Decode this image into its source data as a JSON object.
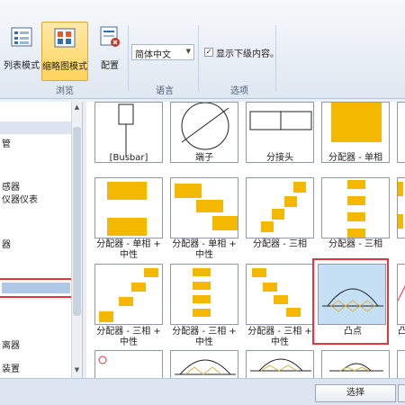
{
  "ribbon": {
    "list_mode": "列表模式",
    "thumb_mode": "缩略图模式",
    "config": "配置",
    "browse_group": "浏览",
    "language_value": "简体中文",
    "language_group": "语言",
    "show_sub": "显示下级内容。",
    "options_group": "选项"
  },
  "tree": {
    "items": [
      "管",
      "感器",
      "仪器仪表",
      "器",
      "离器",
      "装置"
    ]
  },
  "gallery": {
    "row1": [
      "[Busbar]",
      "端子",
      "分接头",
      "分配器 - 单相"
    ],
    "row2": [
      "分配器 - 单相 +",
      "中性",
      "分配器 - 单相 +",
      "中性",
      "分配器 - 三相",
      "分配器 - 三相"
    ],
    "row3": [
      "分配器 - 三相 +",
      "中性",
      "分配器 - 三相 +",
      "中性",
      "分配器 - 三相 +",
      "中性",
      "凸点"
    ],
    "row3_right": "凸"
  },
  "colors": {
    "accent": "#f5b800",
    "selection": "#e5353b",
    "highlight": "#c5e0f5"
  },
  "footer": {
    "select": "选择"
  }
}
